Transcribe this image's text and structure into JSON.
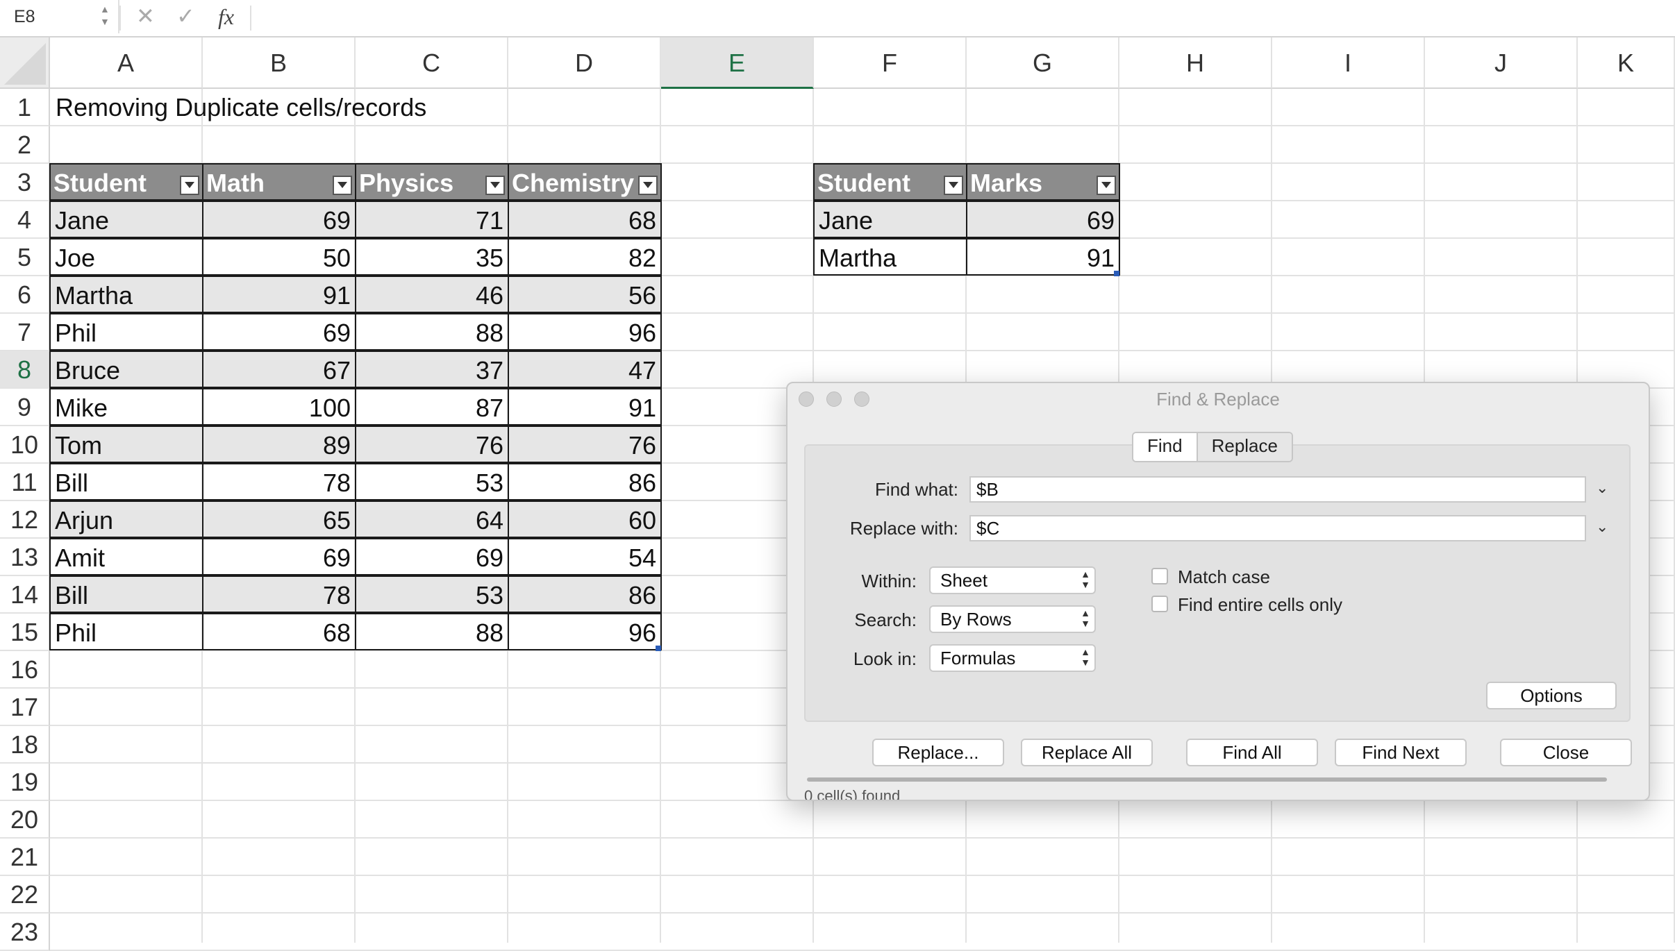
{
  "formula_bar": {
    "name_box": "E8",
    "cancel_icon": "✕",
    "enter_icon": "✓",
    "fx_label": "fx"
  },
  "sheet": {
    "columns": [
      "A",
      "B",
      "C",
      "D",
      "E",
      "F",
      "G",
      "H",
      "I",
      "J",
      "K"
    ],
    "selected_column": "E",
    "rows": [
      "1",
      "2",
      "3",
      "4",
      "5",
      "6",
      "7",
      "8",
      "9",
      "10",
      "11",
      "12",
      "13",
      "14",
      "15",
      "16",
      "17",
      "18",
      "19",
      "20",
      "21",
      "22",
      "23"
    ],
    "selected_row": "8",
    "title": "Removing Duplicate cells/records"
  },
  "table1": {
    "headers": [
      "Student",
      "Math",
      "Physics",
      "Chemistry"
    ],
    "rows": [
      [
        "Jane",
        "69",
        "71",
        "68"
      ],
      [
        "Joe",
        "50",
        "35",
        "82"
      ],
      [
        "Martha",
        "91",
        "46",
        "56"
      ],
      [
        "Phil",
        "69",
        "88",
        "96"
      ],
      [
        "Bruce",
        "67",
        "37",
        "47"
      ],
      [
        "Mike",
        "100",
        "87",
        "91"
      ],
      [
        "Tom",
        "89",
        "76",
        "76"
      ],
      [
        "Bill",
        "78",
        "53",
        "86"
      ],
      [
        "Arjun",
        "65",
        "64",
        "60"
      ],
      [
        "Amit",
        "69",
        "69",
        "54"
      ],
      [
        "Bill",
        "78",
        "53",
        "86"
      ],
      [
        "Phil",
        "68",
        "88",
        "96"
      ]
    ]
  },
  "table2": {
    "headers": [
      "Student",
      "Marks"
    ],
    "rows": [
      [
        "Jane",
        "69"
      ],
      [
        "Martha",
        "91"
      ]
    ]
  },
  "dialog": {
    "title": "Find & Replace",
    "tabs": [
      "Find",
      "Replace"
    ],
    "active_tab": "Find",
    "find_label": "Find what:",
    "find_value": "$B",
    "replace_label": "Replace with:",
    "replace_value": "$C",
    "within_label": "Within:",
    "within_value": "Sheet",
    "search_label": "Search:",
    "search_value": "By Rows",
    "lookin_label": "Look in:",
    "lookin_value": "Formulas",
    "match_case_label": "Match case",
    "entire_cells_label": "Find entire cells only",
    "options_label": "Options",
    "replace_btn": "Replace...",
    "replace_all_btn": "Replace All",
    "find_all_btn": "Find All",
    "find_next_btn": "Find Next",
    "close_btn": "Close",
    "status_text": "0 cell(s) found"
  },
  "colors": {
    "selection_green": "#1e7145",
    "table_header_gray": "#8c8c8c",
    "band_gray": "#e6e6e6"
  }
}
